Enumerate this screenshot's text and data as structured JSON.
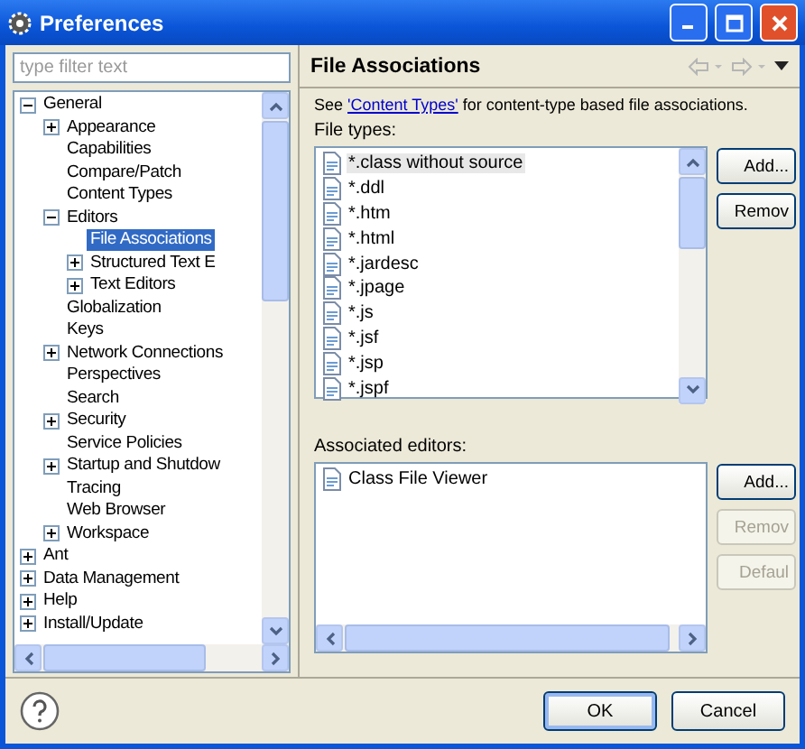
{
  "window": {
    "title": "Preferences"
  },
  "filter": {
    "placeholder": "type filter text"
  },
  "tree": [
    {
      "label": "General",
      "expanded": true,
      "selected": false,
      "children": [
        {
          "label": "Appearance",
          "expanded": false,
          "selected": false
        },
        {
          "label": "Capabilities",
          "selected": false
        },
        {
          "label": "Compare/Patch",
          "selected": false
        },
        {
          "label": "Content Types",
          "selected": false
        },
        {
          "label": "Editors",
          "expanded": true,
          "selected": false,
          "children": [
            {
              "label": "File Associations",
              "selected": true
            },
            {
              "label": "Structured Text E",
              "expanded": false,
              "selected": false
            },
            {
              "label": "Text Editors",
              "expanded": false,
              "selected": false
            }
          ]
        },
        {
          "label": "Globalization",
          "selected": false
        },
        {
          "label": "Keys",
          "selected": false
        },
        {
          "label": "Network Connections",
          "expanded": false,
          "selected": false
        },
        {
          "label": "Perspectives",
          "selected": false
        },
        {
          "label": "Search",
          "selected": false
        },
        {
          "label": "Security",
          "expanded": false,
          "selected": false
        },
        {
          "label": "Service Policies",
          "selected": false
        },
        {
          "label": "Startup and Shutdow",
          "expanded": false,
          "selected": false
        },
        {
          "label": "Tracing",
          "selected": false
        },
        {
          "label": "Web Browser",
          "selected": false
        },
        {
          "label": "Workspace",
          "expanded": false,
          "selected": false
        }
      ]
    },
    {
      "label": "Ant",
      "expanded": false,
      "selected": false
    },
    {
      "label": "Data Management",
      "expanded": false,
      "selected": false
    },
    {
      "label": "Help",
      "expanded": false,
      "selected": false
    },
    {
      "label": "Install/Update",
      "expanded": false,
      "selected": false
    }
  ],
  "page": {
    "title": "File Associations",
    "intro_before": "See ",
    "intro_link": "'Content Types'",
    "intro_after": " for content-type based file associations.",
    "file_types_label": "File types:",
    "file_types": [
      {
        "label": "*.class without source",
        "selected": true
      },
      {
        "label": "*.ddl",
        "selected": false
      },
      {
        "label": "*.htm",
        "selected": false
      },
      {
        "label": "*.html",
        "selected": false
      },
      {
        "label": "*.jardesc",
        "selected": false
      },
      {
        "label": "*.jpage",
        "selected": false
      },
      {
        "label": "*.js",
        "selected": false
      },
      {
        "label": "*.jsf",
        "selected": false
      },
      {
        "label": "*.jsp",
        "selected": false
      },
      {
        "label": "*.jspf",
        "selected": false
      }
    ],
    "file_type_buttons": [
      {
        "label": "Add...",
        "disabled": false
      },
      {
        "label": "Remov",
        "disabled": false
      }
    ],
    "editors_label": "Associated editors:",
    "editors": [
      {
        "label": "Class File Viewer",
        "selected": false
      }
    ],
    "editor_buttons": [
      {
        "label": "Add...",
        "disabled": false
      },
      {
        "label": "Remov",
        "disabled": true
      },
      {
        "label": "Defaul",
        "disabled": true
      }
    ]
  },
  "buttons": [
    {
      "label": "OK",
      "default": true
    },
    {
      "label": "Cancel",
      "default": false
    }
  ]
}
